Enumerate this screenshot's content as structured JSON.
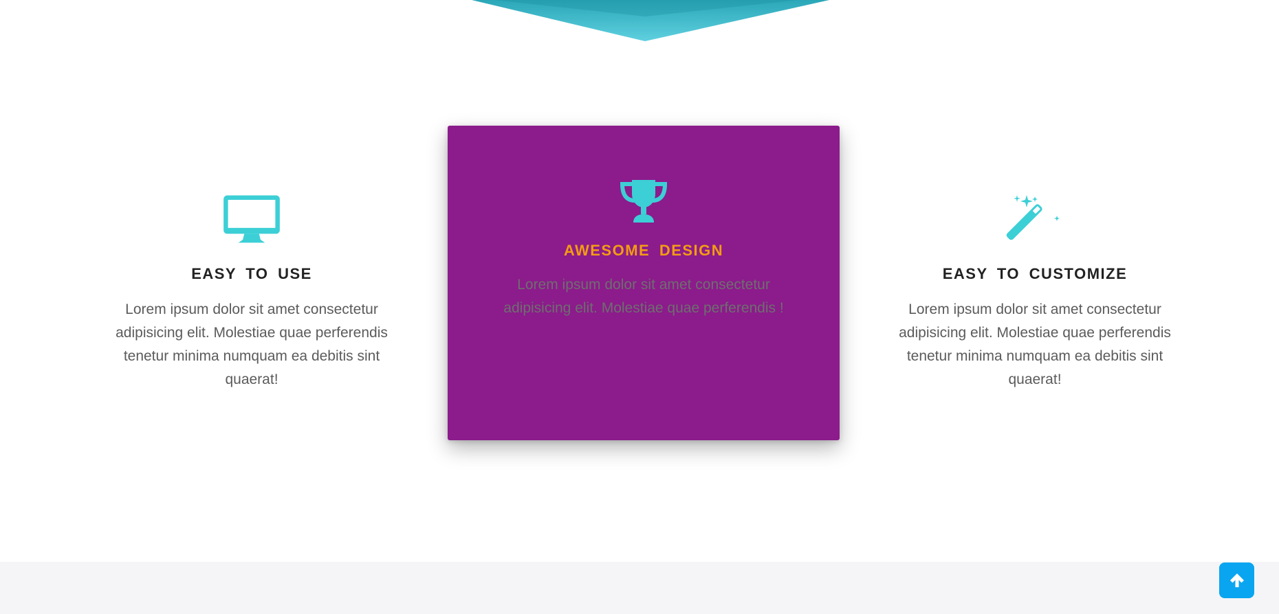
{
  "colors": {
    "accent_teal": "#3ccfd6",
    "card_purple": "#8c1b8c",
    "card_title_orange": "#f39c12",
    "scroll_button_blue": "#0aa5f0",
    "footer_bg": "#f5f5f7"
  },
  "features": [
    {
      "icon": "desktop-monitor-icon",
      "title": "EASY  TO  USE",
      "description": "Lorem ipsum dolor sit amet consectetur adipisicing elit. Molestiae quae perferendis tenetur minima numquam ea debitis sint quaerat!"
    },
    {
      "icon": "trophy-icon",
      "title": "AWESOME  DESIGN",
      "description": "Lorem ipsum dolor sit amet consectetur adipisicing elit. Molestiae quae perferendis !"
    },
    {
      "icon": "magic-wand-icon",
      "title": "EASY  TO  CUSTOMIZE",
      "description": "Lorem ipsum dolor sit amet consectetur adipisicing elit. Molestiae quae perferendis tenetur minima numquam ea debitis sint quaerat!"
    }
  ],
  "scroll_top": {
    "icon": "arrow-up-icon"
  }
}
